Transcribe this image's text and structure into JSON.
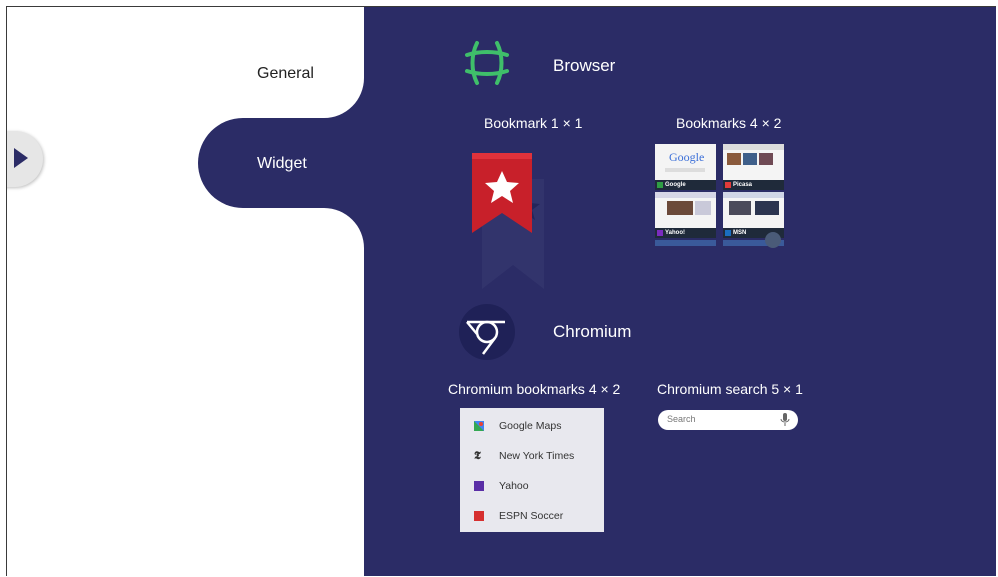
{
  "nav": {
    "general_label": "General",
    "widget_label": "Widget"
  },
  "browser": {
    "title": "Browser",
    "bookmark_1x1_label": "Bookmark  1 × 1",
    "bookmarks_4x2_label": "Bookmarks  4 × 2",
    "thumbnails": [
      "Google",
      "Picasa",
      "Yahoo!",
      "MSN"
    ],
    "google_logo_text": "Google"
  },
  "chromium": {
    "title": "Chromium",
    "bookmarks_label": "Chromium bookmarks  4 × 2",
    "search_label": "Chromium search  5 × 1",
    "list_items": [
      "Google Maps",
      "New York Times",
      "Yahoo",
      "ESPN Soccer"
    ],
    "search_placeholder": "Search"
  },
  "icons": {
    "collapse": "play-triangle-icon",
    "browser": "globe-grid-icon",
    "chromium": "chromium-icon",
    "bookmark": "star-ribbon-icon",
    "mic": "microphone-icon"
  },
  "colors": {
    "content_bg": "#2b2c66",
    "browser_icon": "#3fbf6a",
    "bookmark_red": "#c8202a"
  }
}
